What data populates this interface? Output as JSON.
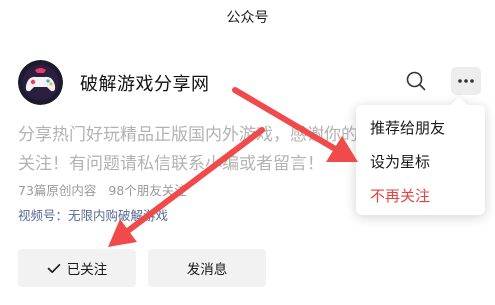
{
  "header": {
    "title": "公众号"
  },
  "account": {
    "name": "破解游戏分享网",
    "description": "分享热门好玩精品正版国内外游戏，感谢你的关注！有问题请私信联系小编或者留言！",
    "original_count": "73篇原创内容",
    "friends_following": "98个朋友关注",
    "channel": "视频号：无限内购破解游戏"
  },
  "actions": {
    "follow_label": "已关注",
    "message_label": "发消息"
  },
  "menu": {
    "items": [
      {
        "label": "推荐给朋友"
      },
      {
        "label": "设为星标"
      },
      {
        "label": "不再关注"
      }
    ]
  },
  "colors": {
    "link": "#576b95",
    "danger": "#e64340",
    "annotation": "#f04a4a",
    "button_bg": "#f2f2f2"
  },
  "icons": [
    "search-icon",
    "more-icon",
    "check-icon"
  ]
}
